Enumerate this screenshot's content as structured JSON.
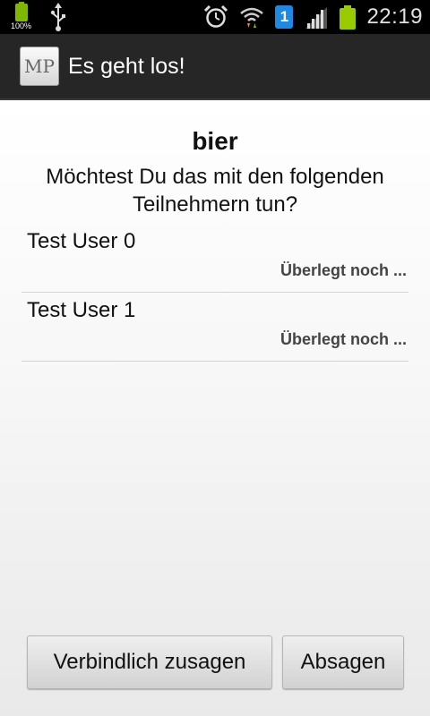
{
  "status_bar": {
    "battery_percent_label": "100%",
    "sim_slot": "1",
    "time": "22:19"
  },
  "action_bar": {
    "logo_text": "MP",
    "title": "Es geht los!"
  },
  "event": {
    "name": "bier",
    "question": "Möchtest Du das mit den folgenden Teilnehmern tun?"
  },
  "participants": [
    {
      "name": "Test User 0",
      "state": "Überlegt noch ..."
    },
    {
      "name": "Test User 1",
      "state": "Überlegt noch ..."
    }
  ],
  "buttons": {
    "commit_label": "Verbindlich zusagen",
    "decline_label": "Absagen"
  },
  "colors": {
    "status_bar_bg": "#000000",
    "action_bar_bg": "#262626",
    "battery_green": "#99cc00",
    "sim_blue": "#1e88e5"
  }
}
